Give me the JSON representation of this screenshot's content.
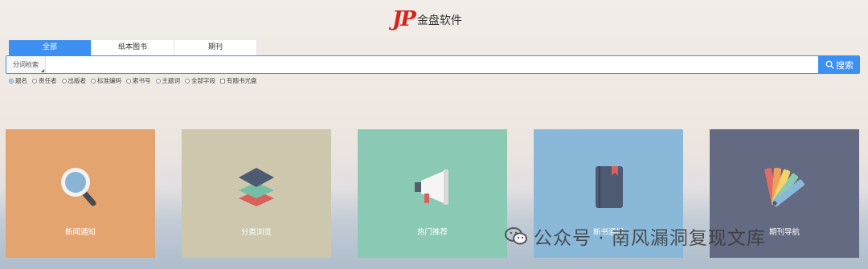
{
  "logo": {
    "mark": "JP",
    "text": "金盘软件"
  },
  "tabs": [
    {
      "label": "全部",
      "active": true
    },
    {
      "label": "纸本图书",
      "active": false
    },
    {
      "label": "期刊",
      "active": false
    }
  ],
  "search": {
    "type_label": "分词检索",
    "value": "",
    "placeholder": "",
    "button_label": "搜索"
  },
  "fields": [
    {
      "label": "题名",
      "kind": "radio",
      "checked": true
    },
    {
      "label": "责任者",
      "kind": "radio",
      "checked": false
    },
    {
      "label": "出版者",
      "kind": "radio",
      "checked": false
    },
    {
      "label": "标准编码",
      "kind": "radio",
      "checked": false
    },
    {
      "label": "索书号",
      "kind": "radio",
      "checked": false
    },
    {
      "label": "主题词",
      "kind": "radio",
      "checked": false
    },
    {
      "label": "全部字段",
      "kind": "radio",
      "checked": false
    },
    {
      "label": "有随书光盘",
      "kind": "checkbox",
      "checked": false
    }
  ],
  "cards": [
    {
      "label": "新闻通知",
      "icon": "magnifier-icon",
      "color": "#e3a470"
    },
    {
      "label": "分类浏览",
      "icon": "layers-icon",
      "color": "#ccc7ad"
    },
    {
      "label": "热门推荐",
      "icon": "megaphone-icon",
      "color": "#8ac9b4"
    },
    {
      "label": "新书通报",
      "icon": "book-icon",
      "color": "#8ab8d9"
    },
    {
      "label": "期刊导航",
      "icon": "color-swatch-icon",
      "color": "#636a82"
    }
  ],
  "watermark": {
    "text": "公众号 · 南风漏洞复现文库",
    "icon": "wechat-icon"
  },
  "colors": {
    "accent": "#3d8ff2",
    "logo_red": "#d7231b"
  }
}
